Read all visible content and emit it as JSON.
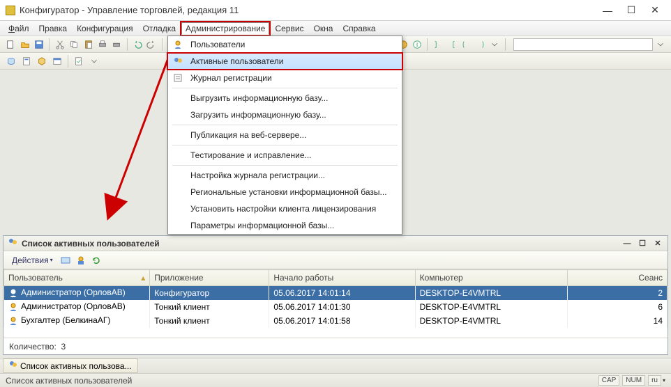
{
  "window": {
    "title": "Конфигуратор - Управление торговлей, редакция 11"
  },
  "menubar": {
    "items": [
      {
        "label": "Файл",
        "underline": "Ф"
      },
      {
        "label": "Правка",
        "underline": "П"
      },
      {
        "label": "Конфигурация"
      },
      {
        "label": "Отладка"
      },
      {
        "label": "Администрирование",
        "underline": "А",
        "active": true
      },
      {
        "label": "Сервис",
        "underline": "С"
      },
      {
        "label": "Окна",
        "underline": "О"
      },
      {
        "label": "Справка"
      }
    ]
  },
  "dropdown": {
    "items": [
      {
        "label": "Пользователи",
        "icon": "user-icon"
      },
      {
        "label": "Активные пользователи",
        "icon": "users-icon",
        "selected": true,
        "highlighted": true
      },
      {
        "label": "Журнал регистрации",
        "icon": "log-icon"
      },
      {
        "sep": true
      },
      {
        "label": "Выгрузить информационную базу..."
      },
      {
        "label": "Загрузить информационную базу..."
      },
      {
        "sep": true
      },
      {
        "label": "Публикация на веб-сервере..."
      },
      {
        "sep": true
      },
      {
        "label": "Тестирование и исправление..."
      },
      {
        "sep": true
      },
      {
        "label": "Настройка журнала регистрации..."
      },
      {
        "label": "Региональные установки информационной базы..."
      },
      {
        "label": "Установить настройки клиента лицензирования"
      },
      {
        "label": "Параметры информационной базы..."
      }
    ]
  },
  "childwin": {
    "title": "Список активных пользователей",
    "toolbar": {
      "actions_label": "Действия"
    },
    "columns": [
      "Пользователь",
      "Приложение",
      "Начало работы",
      "Компьютер",
      "Сеанс"
    ],
    "rows": [
      {
        "user": "Администратор (ОрловАВ)",
        "app": "Конфигуратор",
        "start": "05.06.2017 14:01:14",
        "comp": "DESKTOP-E4VMTRL",
        "session": "2",
        "selected": true
      },
      {
        "user": "Администратор (ОрловАВ)",
        "app": "Тонкий клиент",
        "start": "05.06.2017 14:01:30",
        "comp": "DESKTOP-E4VMTRL",
        "session": "6"
      },
      {
        "user": "Бухгалтер (БелкинаАГ)",
        "app": "Тонкий клиент",
        "start": "05.06.2017 14:01:58",
        "comp": "DESKTOP-E4VMTRL",
        "session": "14"
      }
    ],
    "footer_label": "Количество:",
    "footer_count": "3"
  },
  "taskbar": {
    "button_label": "Список активных пользова..."
  },
  "statusbar": {
    "text": "Список активных пользователей",
    "indicators": [
      "CAP",
      "NUM",
      "ru"
    ]
  }
}
